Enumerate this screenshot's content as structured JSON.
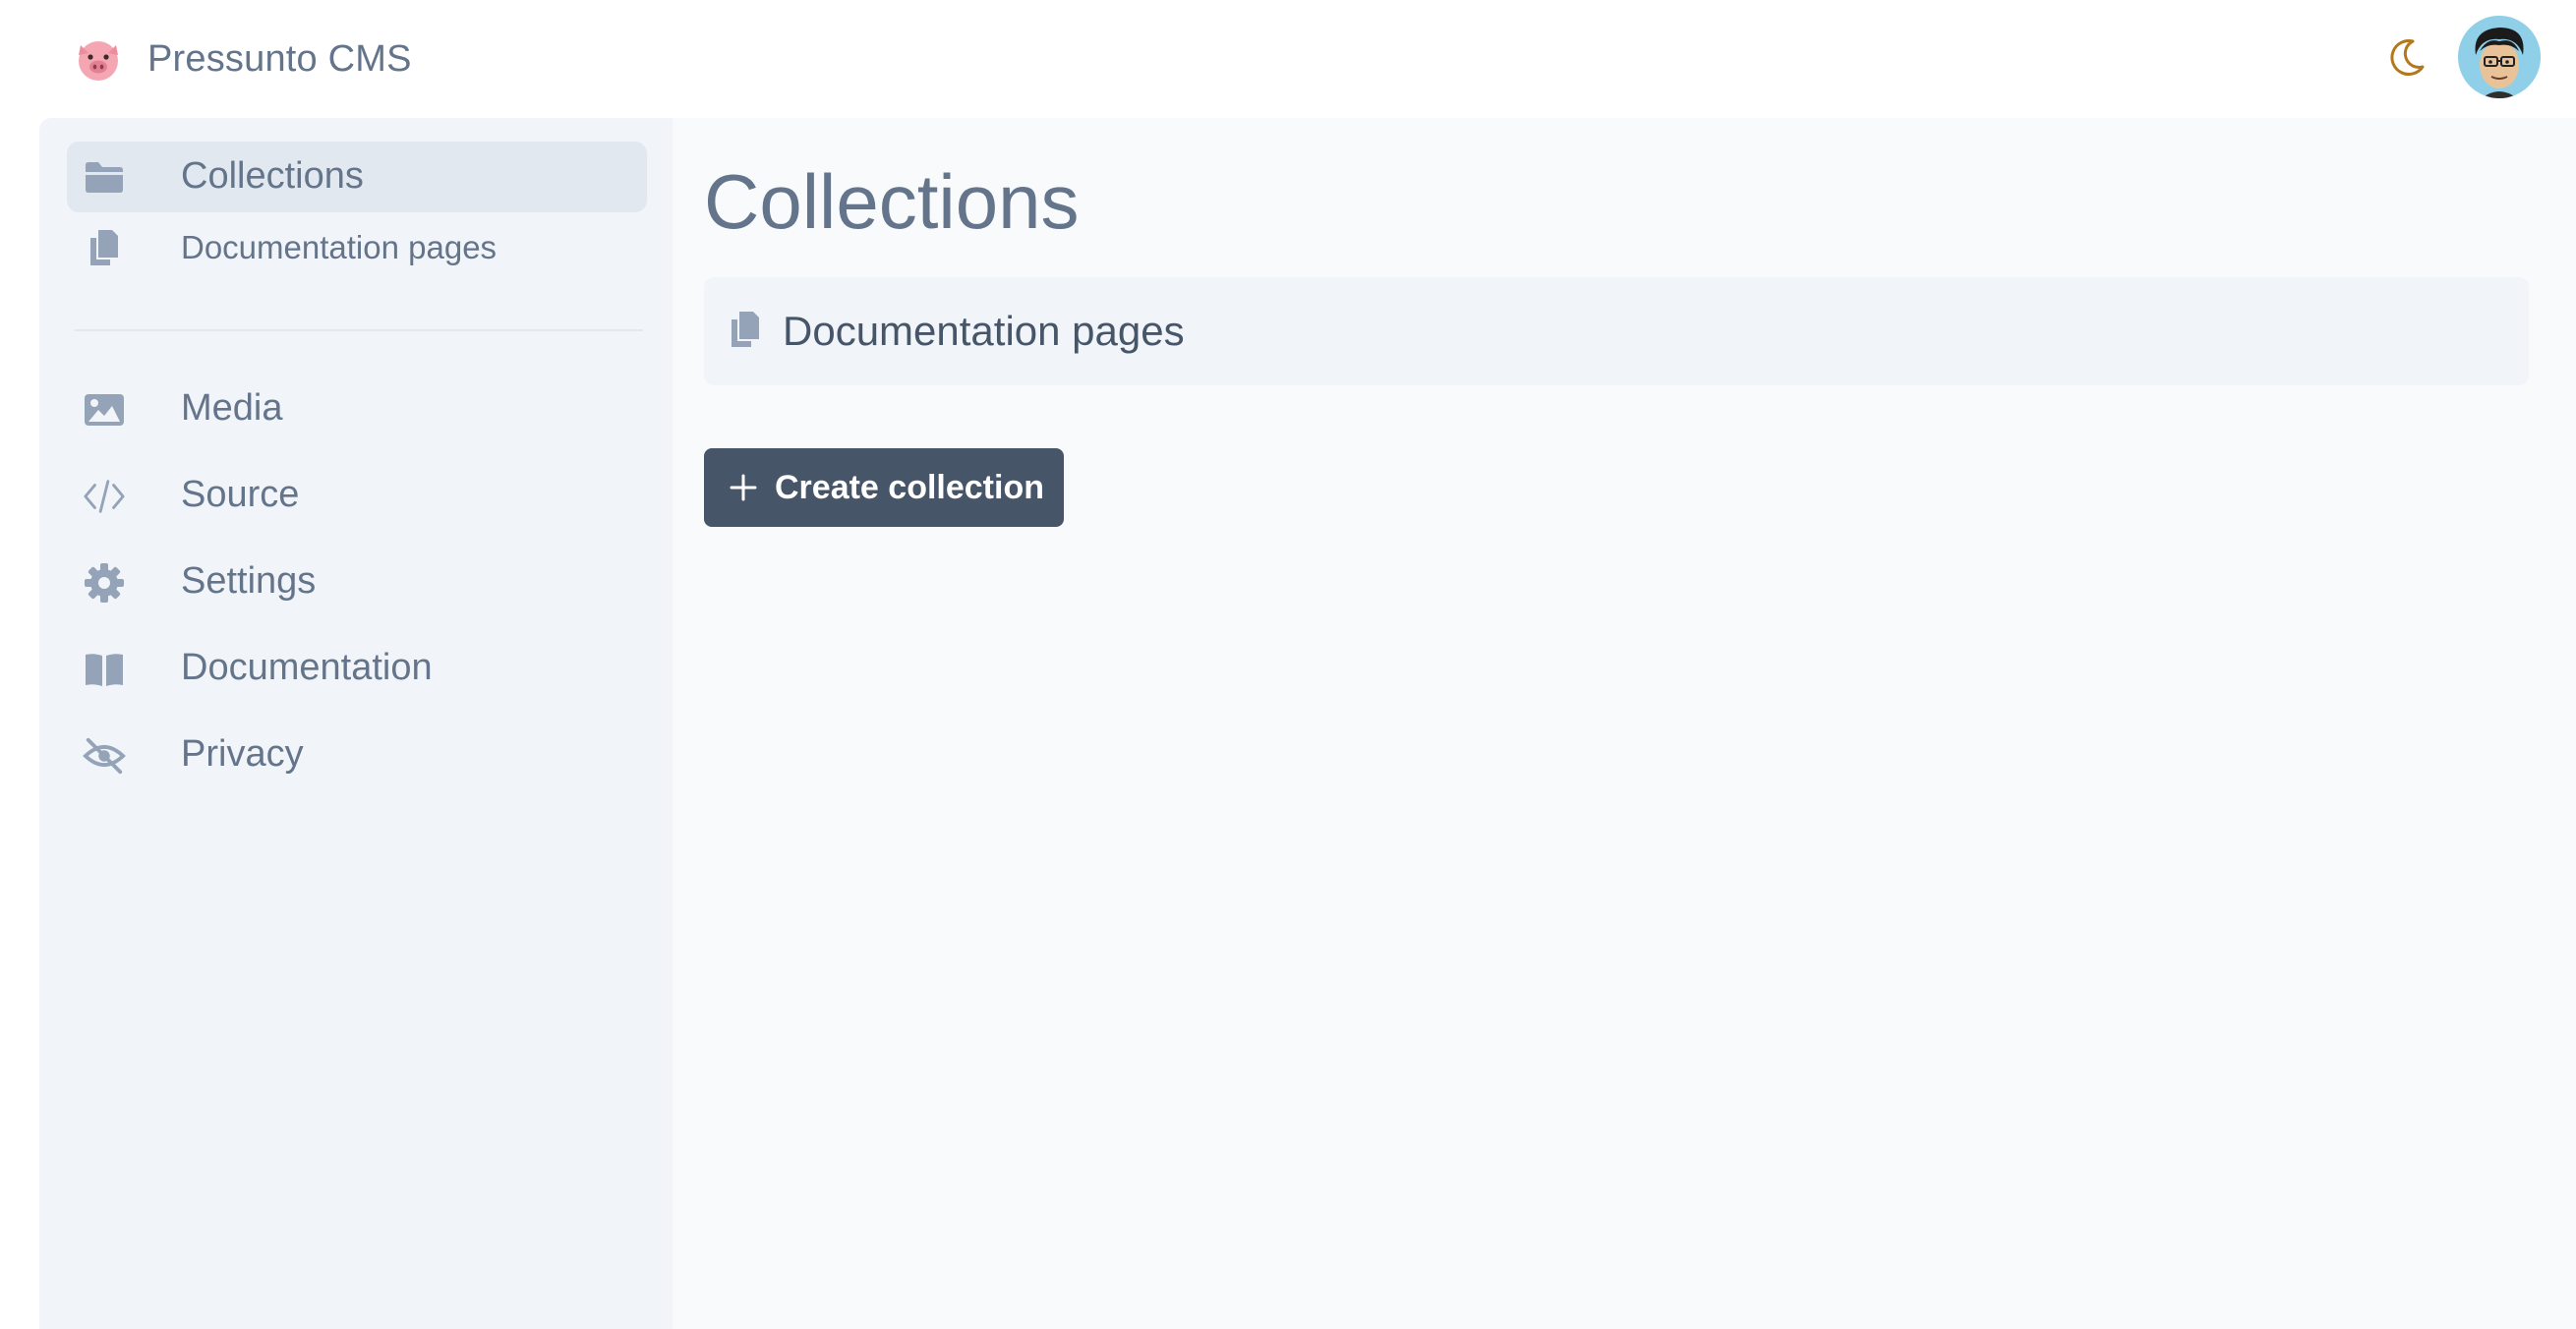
{
  "header": {
    "app_name": "Pressunto CMS",
    "logo_icon": "pig-face-icon",
    "theme_toggle_icon": "moon-icon",
    "avatar_icon": "user-avatar"
  },
  "sidebar": {
    "items": [
      {
        "label": "Collections",
        "icon": "folder-icon",
        "active": true
      },
      {
        "label": "Documentation pages",
        "icon": "copy-icon",
        "active": false
      },
      {
        "label": "Media",
        "icon": "image-icon",
        "active": false
      },
      {
        "label": "Source",
        "icon": "code-icon",
        "active": false
      },
      {
        "label": "Settings",
        "icon": "gear-icon",
        "active": false
      },
      {
        "label": "Documentation",
        "icon": "book-icon",
        "active": false
      },
      {
        "label": "Privacy",
        "icon": "eye-slash-icon",
        "active": false
      }
    ]
  },
  "main": {
    "title": "Collections",
    "collections": [
      {
        "label": "Documentation pages",
        "icon": "copy-icon"
      }
    ],
    "create_button_label": "Create collection"
  },
  "colors": {
    "accent_dark": "#475569",
    "text_muted": "#64748b",
    "sidebar_bg": "#f1f5f9",
    "active_bg": "#e2e8f0",
    "moon_color": "#b4781c"
  }
}
